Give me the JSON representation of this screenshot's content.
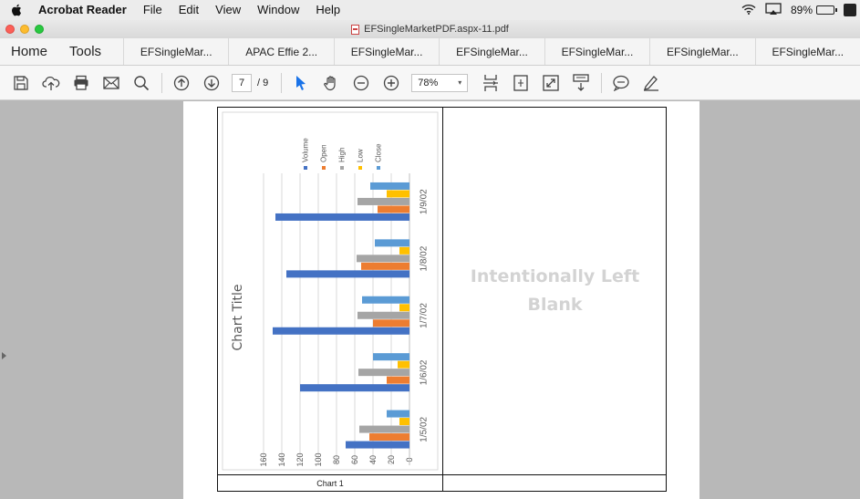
{
  "menubar": {
    "app_name": "Acrobat Reader",
    "items": [
      "File",
      "Edit",
      "View",
      "Window",
      "Help"
    ],
    "battery": "89%"
  },
  "window": {
    "title": "EFSingleMarketPDF.aspx-11.pdf"
  },
  "tabs": {
    "home": "Home",
    "tools": "Tools",
    "docs": [
      "EFSingleMar...",
      "APAC Effie 2...",
      "EFSingleMar...",
      "EFSingleMar...",
      "EFSingleMar...",
      "EFSingleMar...",
      "EFSingleMar..."
    ]
  },
  "toolbar": {
    "page_current": "7",
    "page_total": "/ 9",
    "zoom": "78%"
  },
  "document": {
    "chart_caption": "Chart 1",
    "blank_line1": "Intentionally Left",
    "blank_line2": "Blank"
  },
  "colors": {
    "volume": "#4472c4",
    "open": "#ed7d31",
    "high": "#a5a5a5",
    "low": "#ffc000",
    "close": "#5b9bd5"
  },
  "chart_data": {
    "type": "bar",
    "orientation": "horizontal (page rotated 90°)",
    "title": "Chart Title",
    "categories": [
      "1/5/02",
      "1/6/02",
      "1/7/02",
      "1/8/02",
      "1/9/02"
    ],
    "series": [
      {
        "name": "Volume",
        "values": [
          70,
          120,
          150,
          135,
          147
        ]
      },
      {
        "name": "Open",
        "values": [
          44,
          25,
          40,
          53,
          35
        ]
      },
      {
        "name": "High",
        "values": [
          55,
          56,
          57,
          58,
          57
        ]
      },
      {
        "name": "Low",
        "values": [
          11,
          13,
          11,
          11,
          25
        ]
      },
      {
        "name": "Close",
        "values": [
          25,
          40,
          52,
          38,
          43
        ]
      }
    ],
    "value_ticks": [
      "0",
      "20",
      "40",
      "60",
      "80",
      "100",
      "120",
      "140",
      "160"
    ],
    "vlim": [
      0,
      160
    ],
    "legend": "top",
    "grid": true
  }
}
